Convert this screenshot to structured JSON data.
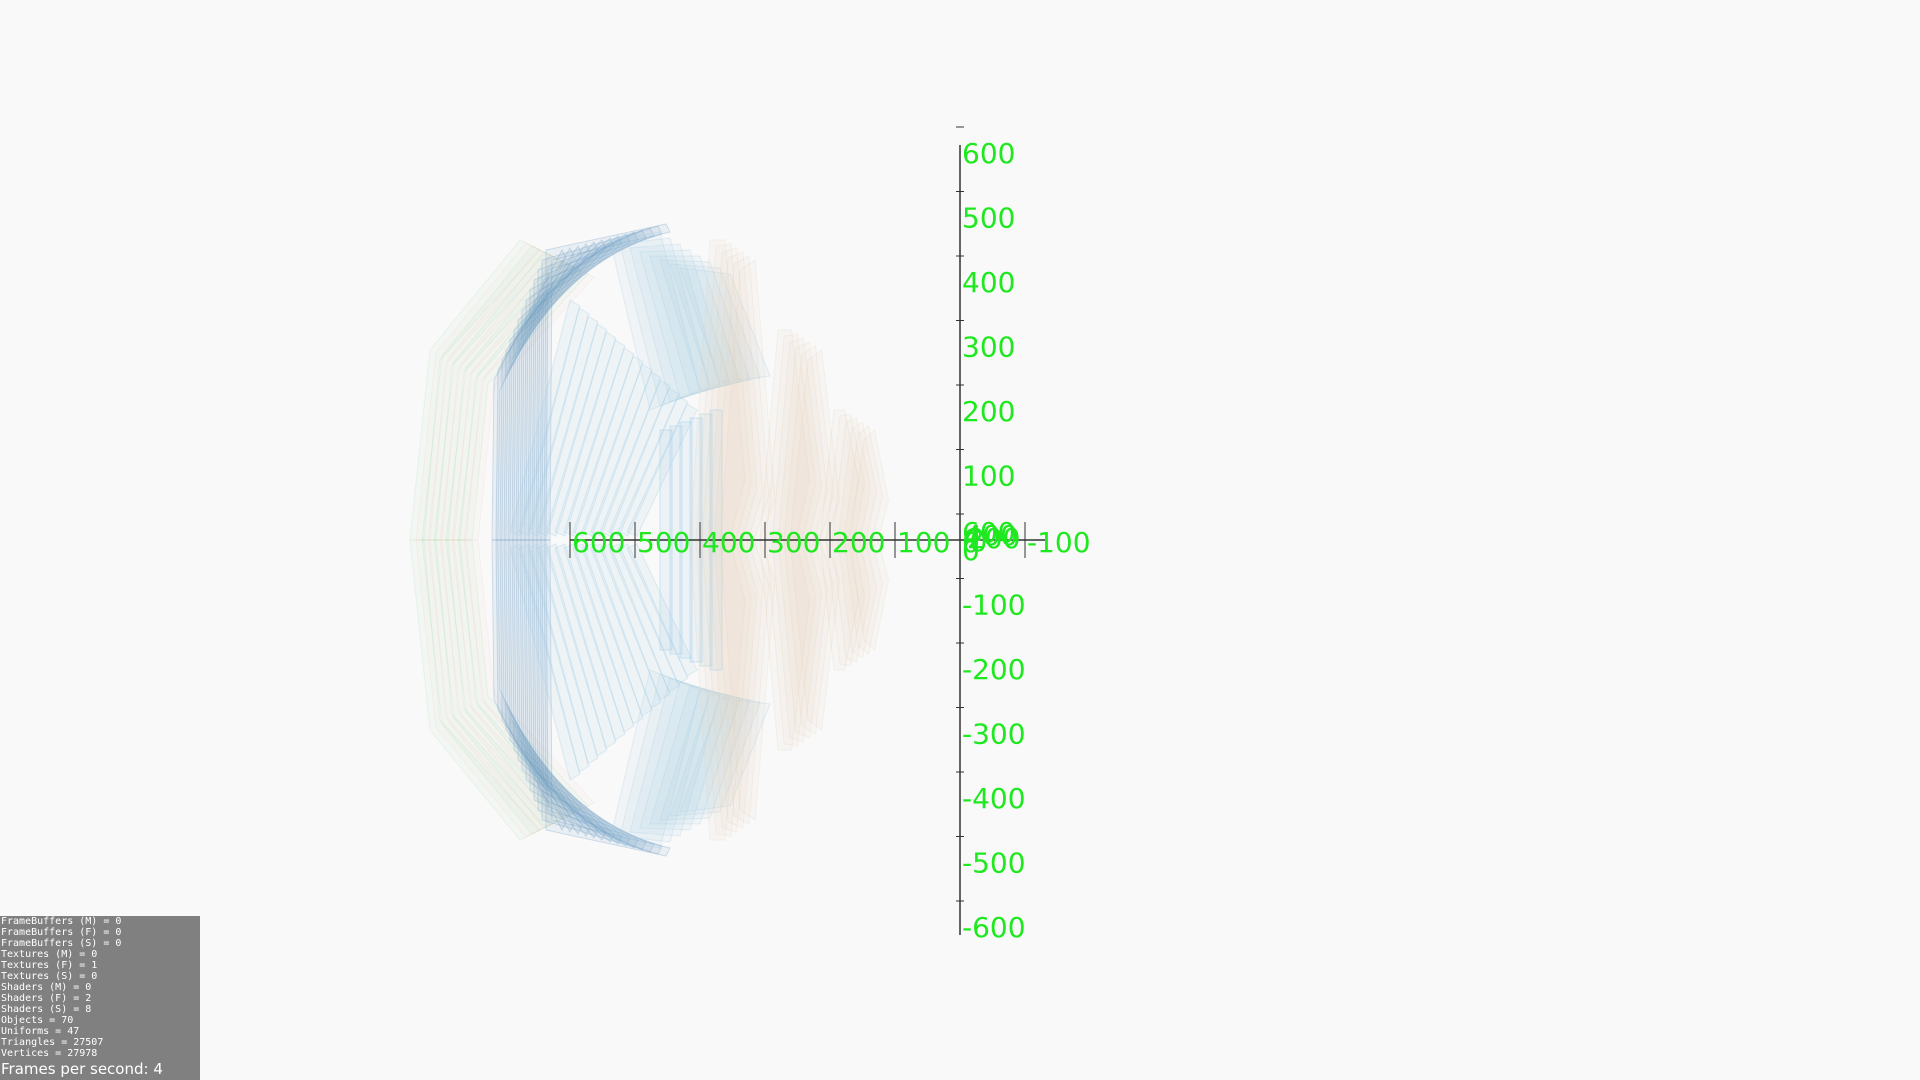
{
  "colors": {
    "background": "#f9f9f9",
    "axis_line": "#333333",
    "axis_label": "#1ee81e",
    "stats_panel_bg": "#808080",
    "stats_text": "#ffffff",
    "mesh_blue": "#6f9ec8",
    "mesh_light_blue": "#a8cfe6",
    "mesh_beige": "#e6d2b4",
    "mesh_green": "#9fd8a8",
    "mesh_pink": "#f0c8c0"
  },
  "axes": {
    "y_labels": [
      "600",
      "500",
      "400",
      "300",
      "200",
      "100",
      "0",
      "-100",
      "-200",
      "-300",
      "-400",
      "-500",
      "-600"
    ],
    "x_labels": [
      "600",
      "500",
      "400",
      "300",
      "200",
      "100",
      "0",
      "-100"
    ],
    "z_labels": [
      "600",
      "400",
      "200",
      "0"
    ]
  },
  "stats": {
    "lines": [
      "FrameBuffers (M) = 0",
      "FrameBuffers (F) = 0",
      "FrameBuffers (S) = 0",
      "Textures (M) = 0",
      "Textures (F) = 1",
      "Textures (S) = 0",
      "Shaders (M) = 0",
      "Shaders (F) = 2",
      "Shaders (S) = 8",
      "Objects = 70",
      "Uniforms = 47",
      "Triangles = 27507",
      "Vertices = 27978"
    ],
    "fps": "Frames per second: 4"
  }
}
